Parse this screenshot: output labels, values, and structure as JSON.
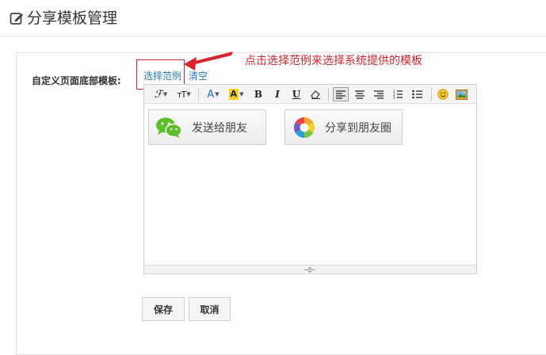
{
  "header": {
    "title": "分享模板管理",
    "icon": "edit-icon"
  },
  "form": {
    "label": "自定义页面底部模板:",
    "links": {
      "example": "选择范例",
      "clear": "清空"
    },
    "callout": "点击选择范例来选择系统提供的模板",
    "callout_color": "#d9232d"
  },
  "editor": {
    "toolbar": {
      "font": "ℱ",
      "font_size": "тT",
      "font_color": "A",
      "highlight": "A",
      "bold": "B",
      "italic": "I",
      "underline": "U"
    },
    "content": {
      "send_to_friend": "发送给朋友",
      "share_moments": "分享到朋友圈"
    }
  },
  "actions": {
    "save": "保存",
    "cancel": "取消"
  },
  "colors": {
    "link": "#2a7ac2",
    "wechat_green": "#5fbf2b"
  }
}
